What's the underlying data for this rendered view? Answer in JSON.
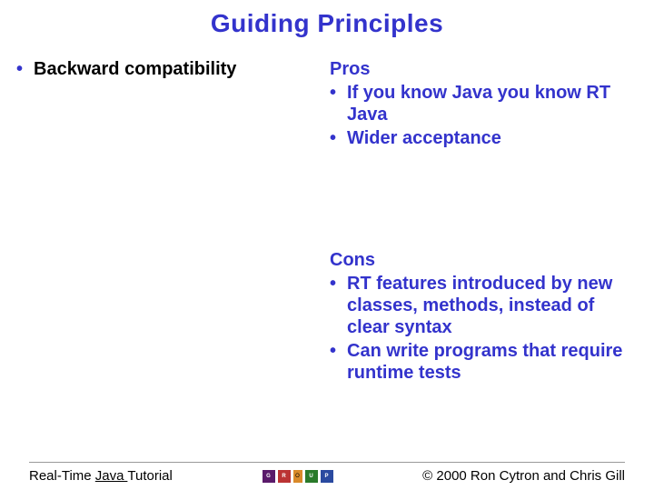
{
  "title": "Guiding Principles",
  "left": {
    "bullet1": "Backward compatibility"
  },
  "right": {
    "pros_heading": "Pros",
    "pros_items": {
      "0": "If you know Java you know RT Java",
      "1": "Wider acceptance"
    },
    "cons_heading": "Cons",
    "cons_items": {
      "0": "RT features introduced by new classes, methods, instead of clear syntax",
      "1": "Can write programs that require runtime tests"
    }
  },
  "footer": {
    "left_pre": "Real-Time ",
    "left_under": "Java ",
    "left_post": "Tutorial",
    "logo": {
      "g": "G",
      "r": "R",
      "o": "O",
      "u": "U",
      "p": "P"
    },
    "right": "© 2000 Ron Cytron and Chris Gill"
  }
}
